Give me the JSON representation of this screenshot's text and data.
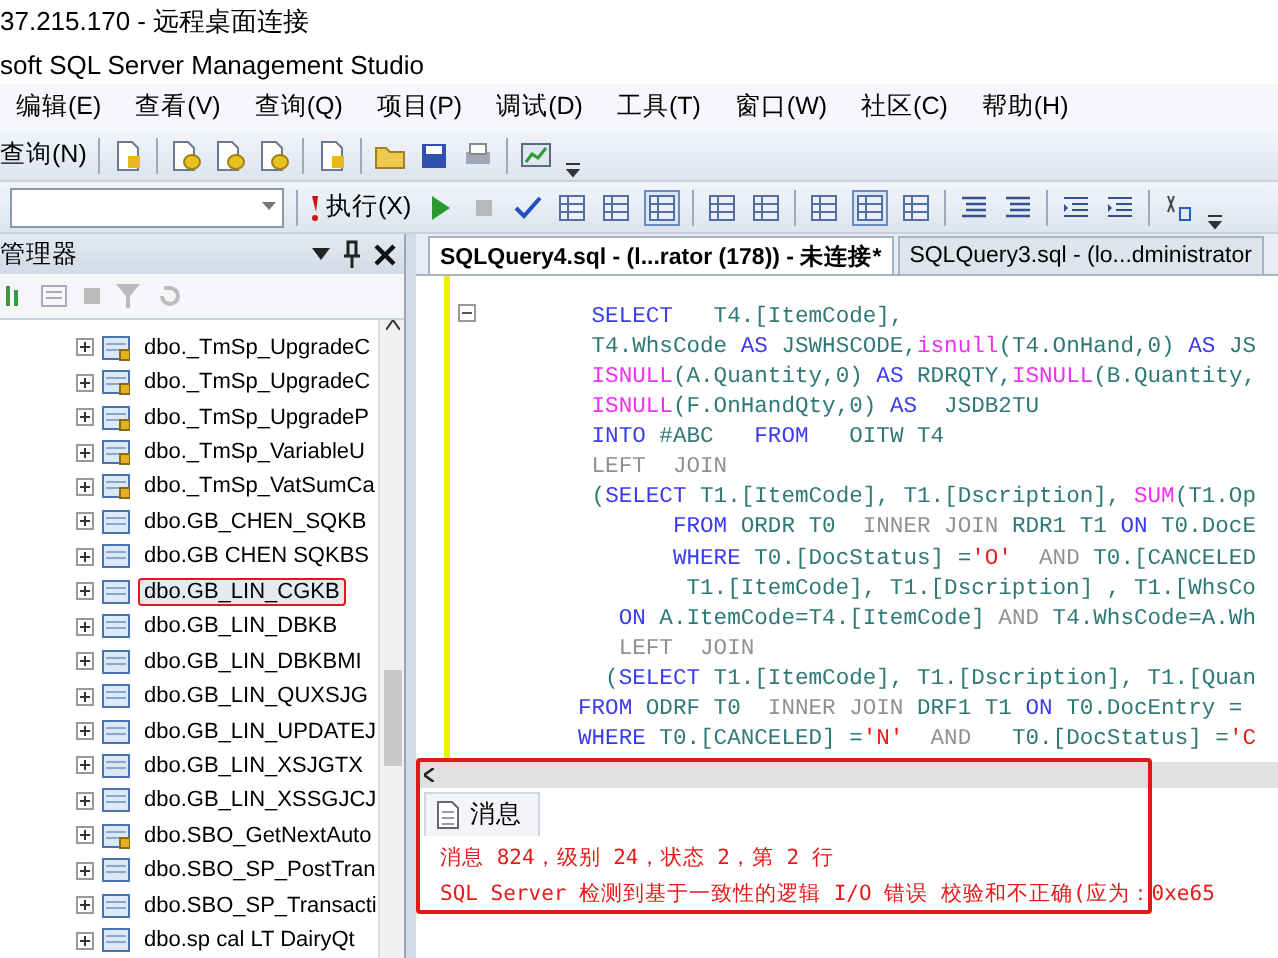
{
  "window": {
    "title": "37.215.170 - 远程桌面连接"
  },
  "app": {
    "title": "soft SQL Server Management Studio"
  },
  "menu": [
    "编辑(E)",
    "查看(V)",
    "查询(Q)",
    "项目(P)",
    "调试(D)",
    "工具(T)",
    "窗口(W)",
    "社区(C)",
    "帮助(H)"
  ],
  "toolbar": {
    "new_query": "查询(N)",
    "execute": "执行(X)"
  },
  "explorer": {
    "title": "管理器",
    "items": [
      {
        "label": "dbo._TmSp_UpgradeC",
        "locked": true,
        "selected": false,
        "marked": false
      },
      {
        "label": "dbo._TmSp_UpgradeC",
        "locked": true,
        "selected": false,
        "marked": false
      },
      {
        "label": "dbo._TmSp_UpgradeP",
        "locked": true,
        "selected": false,
        "marked": false
      },
      {
        "label": "dbo._TmSp_VariableU",
        "locked": true,
        "selected": false,
        "marked": false
      },
      {
        "label": "dbo._TmSp_VatSumCa",
        "locked": true,
        "selected": false,
        "marked": false
      },
      {
        "label": "dbo.GB_CHEN_SQKB",
        "locked": false,
        "selected": false,
        "marked": false
      },
      {
        "label": "dbo.GB CHEN SQKBS",
        "locked": false,
        "selected": false,
        "marked": false
      },
      {
        "label": "dbo.GB_LIN_CGKB",
        "locked": false,
        "selected": true,
        "marked": true
      },
      {
        "label": "dbo.GB_LIN_DBKB",
        "locked": false,
        "selected": false,
        "marked": false
      },
      {
        "label": "dbo.GB_LIN_DBKBMI",
        "locked": false,
        "selected": false,
        "marked": false
      },
      {
        "label": "dbo.GB_LIN_QUXSJG",
        "locked": false,
        "selected": false,
        "marked": false
      },
      {
        "label": "dbo.GB_LIN_UPDATEJ",
        "locked": false,
        "selected": false,
        "marked": false
      },
      {
        "label": "dbo.GB_LIN_XSJGTX",
        "locked": false,
        "selected": false,
        "marked": false
      },
      {
        "label": "dbo.GB_LIN_XSSGJCJ",
        "locked": false,
        "selected": false,
        "marked": false
      },
      {
        "label": "dbo.SBO_GetNextAuto",
        "locked": true,
        "selected": false,
        "marked": false
      },
      {
        "label": "dbo.SBO_SP_PostTran",
        "locked": false,
        "selected": false,
        "marked": false
      },
      {
        "label": "dbo.SBO_SP_Transacti",
        "locked": false,
        "selected": false,
        "marked": false
      },
      {
        "label": "dbo.sp cal LT DairyQt",
        "locked": false,
        "selected": false,
        "marked": false
      }
    ]
  },
  "editor": {
    "tabs": [
      {
        "label": "SQLQuery4.sql - (l...rator (178)) - 未连接*",
        "selected": true
      },
      {
        "label": "SQLQuery3.sql - (lo...dministrator",
        "selected": false
      }
    ],
    "lines": [
      {
        "segments": [
          {
            "kind": "kw",
            "text": " SELECT"
          },
          {
            "kind": "plain",
            "text": "   T4.[ItemCode],"
          }
        ]
      },
      {
        "segments": [
          {
            "kind": "plain",
            "text": " T4.WhsCode "
          },
          {
            "kind": "kw",
            "text": "AS"
          },
          {
            "kind": "plain",
            "text": " JSWHSCODE,"
          },
          {
            "kind": "fn",
            "text": "isnull"
          },
          {
            "kind": "plain",
            "text": "(T4.OnHand,0) "
          },
          {
            "kind": "kw",
            "text": "AS"
          },
          {
            "kind": "plain",
            "text": " JS"
          }
        ]
      },
      {
        "segments": [
          {
            "kind": "fn",
            "text": " ISNULL"
          },
          {
            "kind": "plain",
            "text": "(A.Quantity,0) "
          },
          {
            "kind": "kw",
            "text": "AS"
          },
          {
            "kind": "plain",
            "text": " RDRQTY,"
          },
          {
            "kind": "fn",
            "text": "ISNULL"
          },
          {
            "kind": "plain",
            "text": "(B.Quantity,"
          }
        ]
      },
      {
        "segments": [
          {
            "kind": "fn",
            "text": " ISNULL"
          },
          {
            "kind": "plain",
            "text": "(F.OnHandQty,0) "
          },
          {
            "kind": "kw",
            "text": "AS"
          },
          {
            "kind": "plain",
            "text": "  JSDB2TU"
          }
        ]
      },
      {
        "segments": [
          {
            "kind": "kw",
            "text": " INTO"
          },
          {
            "kind": "plain",
            "text": " #ABC   "
          },
          {
            "kind": "kw",
            "text": "FROM"
          },
          {
            "kind": "plain",
            "text": "   OITW T4"
          }
        ]
      },
      {
        "segments": [
          {
            "kind": "op",
            "text": " LEFT  JOIN"
          }
        ]
      },
      {
        "segments": [
          {
            "kind": "plain",
            "text": " ("
          },
          {
            "kind": "kw",
            "text": "SELECT"
          },
          {
            "kind": "plain",
            "text": " T1.[ItemCode], T1.[Dscription], "
          },
          {
            "kind": "fn",
            "text": "SUM"
          },
          {
            "kind": "plain",
            "text": "(T1.Op"
          }
        ]
      },
      {
        "segments": [
          {
            "kind": "kw",
            "text": "       FROM"
          },
          {
            "kind": "plain",
            "text": " ORDR T0  "
          },
          {
            "kind": "op",
            "text": "INNER JOIN"
          },
          {
            "kind": "plain",
            "text": " RDR1 T1 "
          },
          {
            "kind": "kw",
            "text": "ON"
          },
          {
            "kind": "plain",
            "text": " T0.DocE"
          }
        ]
      },
      {
        "segments": [
          {
            "kind": "kw",
            "text": "       WHERE"
          },
          {
            "kind": "plain",
            "text": " T0.[DocStatus] ="
          },
          {
            "kind": "str",
            "text": "'O'"
          },
          {
            "kind": "op",
            "text": "  AND"
          },
          {
            "kind": "plain",
            "text": " T0.[CANCELED"
          }
        ]
      },
      {
        "segments": [
          {
            "kind": "plain",
            "text": "        T1.[ItemCode], T1.[Dscription] , T1.[WhsCo"
          }
        ]
      },
      {
        "segments": [
          {
            "kind": "kw",
            "text": "   ON"
          },
          {
            "kind": "plain",
            "text": " A.ItemCode=T4.[ItemCode] "
          },
          {
            "kind": "op",
            "text": "AND"
          },
          {
            "kind": "plain",
            "text": " T4.WhsCode=A.Wh"
          }
        ]
      },
      {
        "segments": [
          {
            "kind": "op",
            "text": "   LEFT  JOIN"
          }
        ]
      },
      {
        "segments": [
          {
            "kind": "plain",
            "text": "  ("
          },
          {
            "kind": "kw",
            "text": "SELECT"
          },
          {
            "kind": "plain",
            "text": " T1.[ItemCode], T1.[Dscription], T1.[Quan"
          }
        ]
      },
      {
        "segments": [
          {
            "kind": "kw",
            "text": "FROM"
          },
          {
            "kind": "plain",
            "text": " ODRF T0  "
          },
          {
            "kind": "op",
            "text": "INNER JOIN"
          },
          {
            "kind": "plain",
            "text": " DRF1 T1 "
          },
          {
            "kind": "kw",
            "text": "ON"
          },
          {
            "kind": "plain",
            "text": " T0.DocEntry ="
          }
        ]
      },
      {
        "segments": [
          {
            "kind": "kw",
            "text": "WHERE"
          },
          {
            "kind": "plain",
            "text": " T0.[CANCELED] ="
          },
          {
            "kind": "str",
            "text": "'N'"
          },
          {
            "kind": "op",
            "text": "  AND"
          },
          {
            "kind": "plain",
            "text": "   T0.[DocStatus] ="
          },
          {
            "kind": "str",
            "text": "'C"
          }
        ]
      }
    ]
  },
  "messages": {
    "tab": "消息",
    "marked": true,
    "lines": [
      "消息 824，级别 24，状态 2，第 2 行",
      "SQL Server 检测到基于一致性的逻辑 I/O 错误 校验和不正确(应为：0xe65"
    ]
  }
}
